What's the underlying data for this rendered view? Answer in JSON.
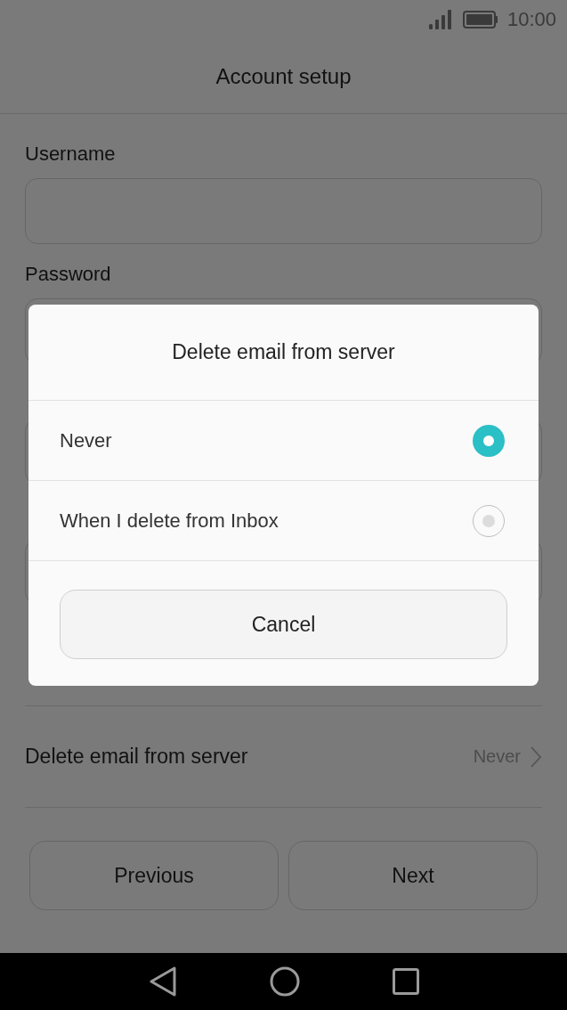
{
  "status_bar": {
    "time": "10:00"
  },
  "header": {
    "title": "Account setup"
  },
  "fields": [
    {
      "kind": "labeled",
      "label": "Username"
    },
    {
      "kind": "labeled",
      "label": "Password"
    },
    {
      "kind": "covered"
    },
    {
      "kind": "covered"
    }
  ],
  "setting": {
    "label": "Delete email from server",
    "value": "Never"
  },
  "buttons": [
    "Previous",
    "Next"
  ],
  "dialog": {
    "title": "Delete email from server",
    "options": [
      {
        "label": "Never",
        "selected": true
      },
      {
        "label": "When I delete from Inbox",
        "selected": false
      }
    ],
    "cancel": "Cancel"
  }
}
